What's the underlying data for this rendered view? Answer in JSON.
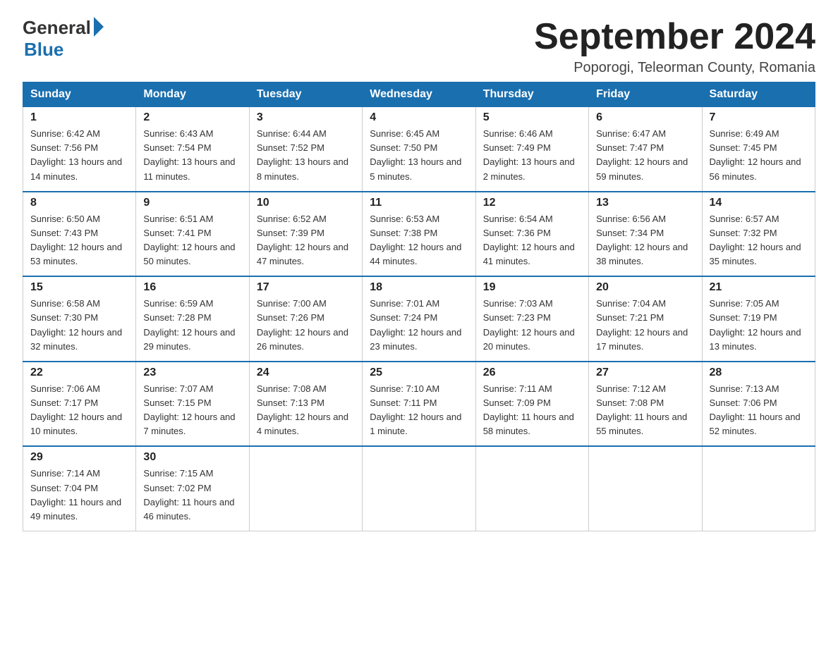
{
  "logo": {
    "general": "General",
    "blue": "Blue"
  },
  "title": "September 2024",
  "location": "Poporogi, Teleorman County, Romania",
  "days_of_week": [
    "Sunday",
    "Monday",
    "Tuesday",
    "Wednesday",
    "Thursday",
    "Friday",
    "Saturday"
  ],
  "weeks": [
    [
      {
        "day": "1",
        "sunrise": "6:42 AM",
        "sunset": "7:56 PM",
        "daylight": "13 hours and 14 minutes."
      },
      {
        "day": "2",
        "sunrise": "6:43 AM",
        "sunset": "7:54 PM",
        "daylight": "13 hours and 11 minutes."
      },
      {
        "day": "3",
        "sunrise": "6:44 AM",
        "sunset": "7:52 PM",
        "daylight": "13 hours and 8 minutes."
      },
      {
        "day": "4",
        "sunrise": "6:45 AM",
        "sunset": "7:50 PM",
        "daylight": "13 hours and 5 minutes."
      },
      {
        "day": "5",
        "sunrise": "6:46 AM",
        "sunset": "7:49 PM",
        "daylight": "13 hours and 2 minutes."
      },
      {
        "day": "6",
        "sunrise": "6:47 AM",
        "sunset": "7:47 PM",
        "daylight": "12 hours and 59 minutes."
      },
      {
        "day": "7",
        "sunrise": "6:49 AM",
        "sunset": "7:45 PM",
        "daylight": "12 hours and 56 minutes."
      }
    ],
    [
      {
        "day": "8",
        "sunrise": "6:50 AM",
        "sunset": "7:43 PM",
        "daylight": "12 hours and 53 minutes."
      },
      {
        "day": "9",
        "sunrise": "6:51 AM",
        "sunset": "7:41 PM",
        "daylight": "12 hours and 50 minutes."
      },
      {
        "day": "10",
        "sunrise": "6:52 AM",
        "sunset": "7:39 PM",
        "daylight": "12 hours and 47 minutes."
      },
      {
        "day": "11",
        "sunrise": "6:53 AM",
        "sunset": "7:38 PM",
        "daylight": "12 hours and 44 minutes."
      },
      {
        "day": "12",
        "sunrise": "6:54 AM",
        "sunset": "7:36 PM",
        "daylight": "12 hours and 41 minutes."
      },
      {
        "day": "13",
        "sunrise": "6:56 AM",
        "sunset": "7:34 PM",
        "daylight": "12 hours and 38 minutes."
      },
      {
        "day": "14",
        "sunrise": "6:57 AM",
        "sunset": "7:32 PM",
        "daylight": "12 hours and 35 minutes."
      }
    ],
    [
      {
        "day": "15",
        "sunrise": "6:58 AM",
        "sunset": "7:30 PM",
        "daylight": "12 hours and 32 minutes."
      },
      {
        "day": "16",
        "sunrise": "6:59 AM",
        "sunset": "7:28 PM",
        "daylight": "12 hours and 29 minutes."
      },
      {
        "day": "17",
        "sunrise": "7:00 AM",
        "sunset": "7:26 PM",
        "daylight": "12 hours and 26 minutes."
      },
      {
        "day": "18",
        "sunrise": "7:01 AM",
        "sunset": "7:24 PM",
        "daylight": "12 hours and 23 minutes."
      },
      {
        "day": "19",
        "sunrise": "7:03 AM",
        "sunset": "7:23 PM",
        "daylight": "12 hours and 20 minutes."
      },
      {
        "day": "20",
        "sunrise": "7:04 AM",
        "sunset": "7:21 PM",
        "daylight": "12 hours and 17 minutes."
      },
      {
        "day": "21",
        "sunrise": "7:05 AM",
        "sunset": "7:19 PM",
        "daylight": "12 hours and 13 minutes."
      }
    ],
    [
      {
        "day": "22",
        "sunrise": "7:06 AM",
        "sunset": "7:17 PM",
        "daylight": "12 hours and 10 minutes."
      },
      {
        "day": "23",
        "sunrise": "7:07 AM",
        "sunset": "7:15 PM",
        "daylight": "12 hours and 7 minutes."
      },
      {
        "day": "24",
        "sunrise": "7:08 AM",
        "sunset": "7:13 PM",
        "daylight": "12 hours and 4 minutes."
      },
      {
        "day": "25",
        "sunrise": "7:10 AM",
        "sunset": "7:11 PM",
        "daylight": "12 hours and 1 minute."
      },
      {
        "day": "26",
        "sunrise": "7:11 AM",
        "sunset": "7:09 PM",
        "daylight": "11 hours and 58 minutes."
      },
      {
        "day": "27",
        "sunrise": "7:12 AM",
        "sunset": "7:08 PM",
        "daylight": "11 hours and 55 minutes."
      },
      {
        "day": "28",
        "sunrise": "7:13 AM",
        "sunset": "7:06 PM",
        "daylight": "11 hours and 52 minutes."
      }
    ],
    [
      {
        "day": "29",
        "sunrise": "7:14 AM",
        "sunset": "7:04 PM",
        "daylight": "11 hours and 49 minutes."
      },
      {
        "day": "30",
        "sunrise": "7:15 AM",
        "sunset": "7:02 PM",
        "daylight": "11 hours and 46 minutes."
      },
      null,
      null,
      null,
      null,
      null
    ]
  ]
}
